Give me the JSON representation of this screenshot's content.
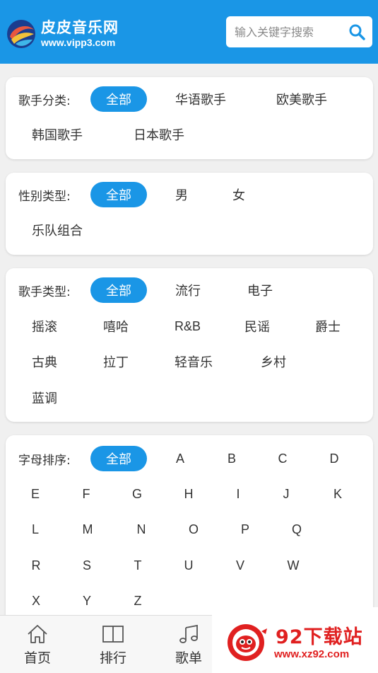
{
  "header": {
    "site_name": "皮皮音乐网",
    "site_url": "www.vipp3.com",
    "search_placeholder": "输入关键字搜索"
  },
  "filters": [
    {
      "label": "歌手分类:",
      "options": [
        "全部",
        "华语歌手",
        "欧美歌手",
        "韩国歌手",
        "日本歌手"
      ],
      "selected": "全部"
    },
    {
      "label": "性别类型:",
      "options": [
        "全部",
        "男",
        "女",
        "乐队组合"
      ],
      "selected": "全部"
    },
    {
      "label": "歌手类型:",
      "options": [
        "全部",
        "流行",
        "电子",
        "摇滚",
        "嘻哈",
        "R&B",
        "民谣",
        "爵士",
        "古典",
        "拉丁",
        "轻音乐",
        "乡村",
        "蓝调"
      ],
      "selected": "全部"
    },
    {
      "label": "字母排序:",
      "options": [
        "全部",
        "A",
        "B",
        "C",
        "D",
        "E",
        "F",
        "G",
        "H",
        "I",
        "J",
        "K",
        "L",
        "M",
        "N",
        "O",
        "P",
        "Q",
        "R",
        "S",
        "T",
        "U",
        "V",
        "W",
        "X",
        "Y",
        "Z"
      ],
      "selected": "全部"
    }
  ],
  "bottom_nav": [
    {
      "label": "首页",
      "icon": "home-icon"
    },
    {
      "label": "排行",
      "icon": "book-icon"
    },
    {
      "label": "歌单",
      "icon": "music-note-icon"
    }
  ],
  "watermark": {
    "title": "92下载站",
    "url": "www.xz92.com"
  },
  "colors": {
    "accent": "#1a96e6",
    "watermark": "#e02020"
  }
}
